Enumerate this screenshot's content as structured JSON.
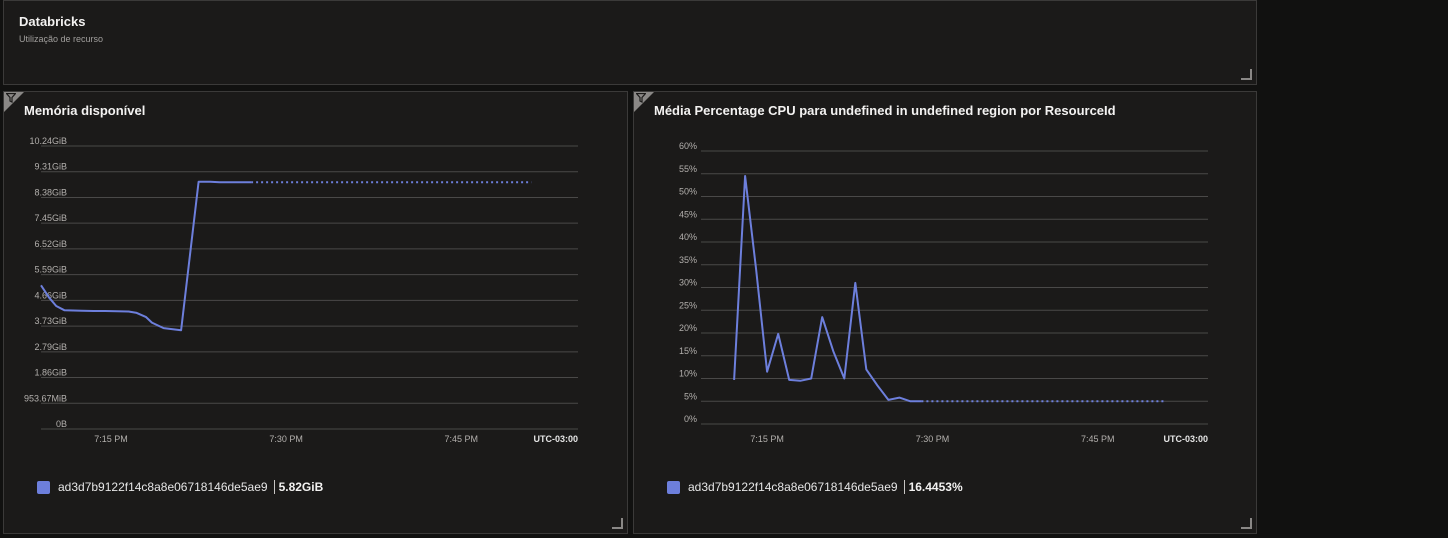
{
  "header": {
    "title": "Databricks",
    "subtitle": "Utilização de recurso"
  },
  "colors": {
    "series": "#6d7fdc",
    "grid": "#4a4948",
    "tile_bg": "#1b1a19"
  },
  "icons": {
    "filter": "filter-icon",
    "resize": "resize-handle-icon"
  },
  "charts": [
    {
      "title": "Memória disponível",
      "legend": {
        "name": "ad3d7b9122f14c8a8e06718146de5ae9",
        "value": "5.82GiB"
      }
    },
    {
      "title": "Média Percentage CPU para undefined in undefined region por ResourceId",
      "legend": {
        "name": "ad3d7b9122f14c8a8e06718146de5ae9",
        "value": "16.4453%"
      }
    }
  ],
  "chart_data": [
    {
      "type": "line",
      "title": "Memória disponível",
      "timezone": "UTC-03:00",
      "x_ticks": [
        "7:15 PM",
        "7:30 PM",
        "7:45 PM"
      ],
      "x_range": [
        "7:09 PM",
        "7:55 PM"
      ],
      "x_tick_minutes": [
        15,
        30,
        45
      ],
      "y_ticks": [
        "0B",
        "953.67MiB",
        "1.86GiB",
        "2.79GiB",
        "3.73GiB",
        "4.66GiB",
        "5.59GiB",
        "6.52GiB",
        "7.45GiB",
        "8.38GiB",
        "9.31GiB",
        "10.24GiB"
      ],
      "y_unit": "GiB",
      "ylim": [
        0,
        10.24
      ],
      "grid": true,
      "series": [
        {
          "name": "ad3d7b9122f14c8a8e06718146de5ae9",
          "x_minutes": [
            9.0,
            9.7,
            10.3,
            11.0,
            12.5,
            13.5,
            14.5,
            15.5,
            16.5,
            17.2,
            18.0,
            18.5,
            19.5,
            21.0,
            22.5,
            23.5,
            24.3,
            25.5,
            27.0
          ],
          "values": [
            5.2,
            4.75,
            4.45,
            4.3,
            4.28,
            4.27,
            4.27,
            4.26,
            4.25,
            4.2,
            4.05,
            3.85,
            3.65,
            3.57,
            8.95,
            8.95,
            8.93,
            8.93,
            8.93
          ],
          "projection": {
            "x_minutes": [
              27.0,
              51.0
            ],
            "values": [
              8.93,
              8.93
            ],
            "style": "dotted"
          }
        }
      ]
    },
    {
      "type": "line",
      "title": "Média Percentage CPU para undefined in undefined region por ResourceId",
      "timezone": "UTC-03:00",
      "x_ticks": [
        "7:15 PM",
        "7:30 PM",
        "7:45 PM"
      ],
      "x_range": [
        "7:09 PM",
        "7:55 PM"
      ],
      "x_tick_minutes": [
        15,
        30,
        45
      ],
      "y_ticks": [
        "0%",
        "5%",
        "10%",
        "15%",
        "20%",
        "25%",
        "30%",
        "35%",
        "40%",
        "45%",
        "50%",
        "55%",
        "60%"
      ],
      "y_unit": "%",
      "ylim": [
        0,
        60
      ],
      "grid": true,
      "series": [
        {
          "name": "ad3d7b9122f14c8a8e06718146de5ae9",
          "x_minutes": [
            12.0,
            13.0,
            14.0,
            15.0,
            16.0,
            17.0,
            18.0,
            19.0,
            20.0,
            21.0,
            22.0,
            23.0,
            24.0,
            25.0,
            26.0,
            27.0,
            28.0,
            29.0
          ],
          "values": [
            9.7,
            54.5,
            34.0,
            11.5,
            19.8,
            9.7,
            9.5,
            10.0,
            23.5,
            16.0,
            10.0,
            31.0,
            12.0,
            8.5,
            5.3,
            5.8,
            5.0,
            5.0
          ],
          "projection": {
            "x_minutes": [
              29.0,
              51.0
            ],
            "values": [
              5.0,
              5.0
            ],
            "style": "dotted"
          }
        }
      ]
    }
  ]
}
